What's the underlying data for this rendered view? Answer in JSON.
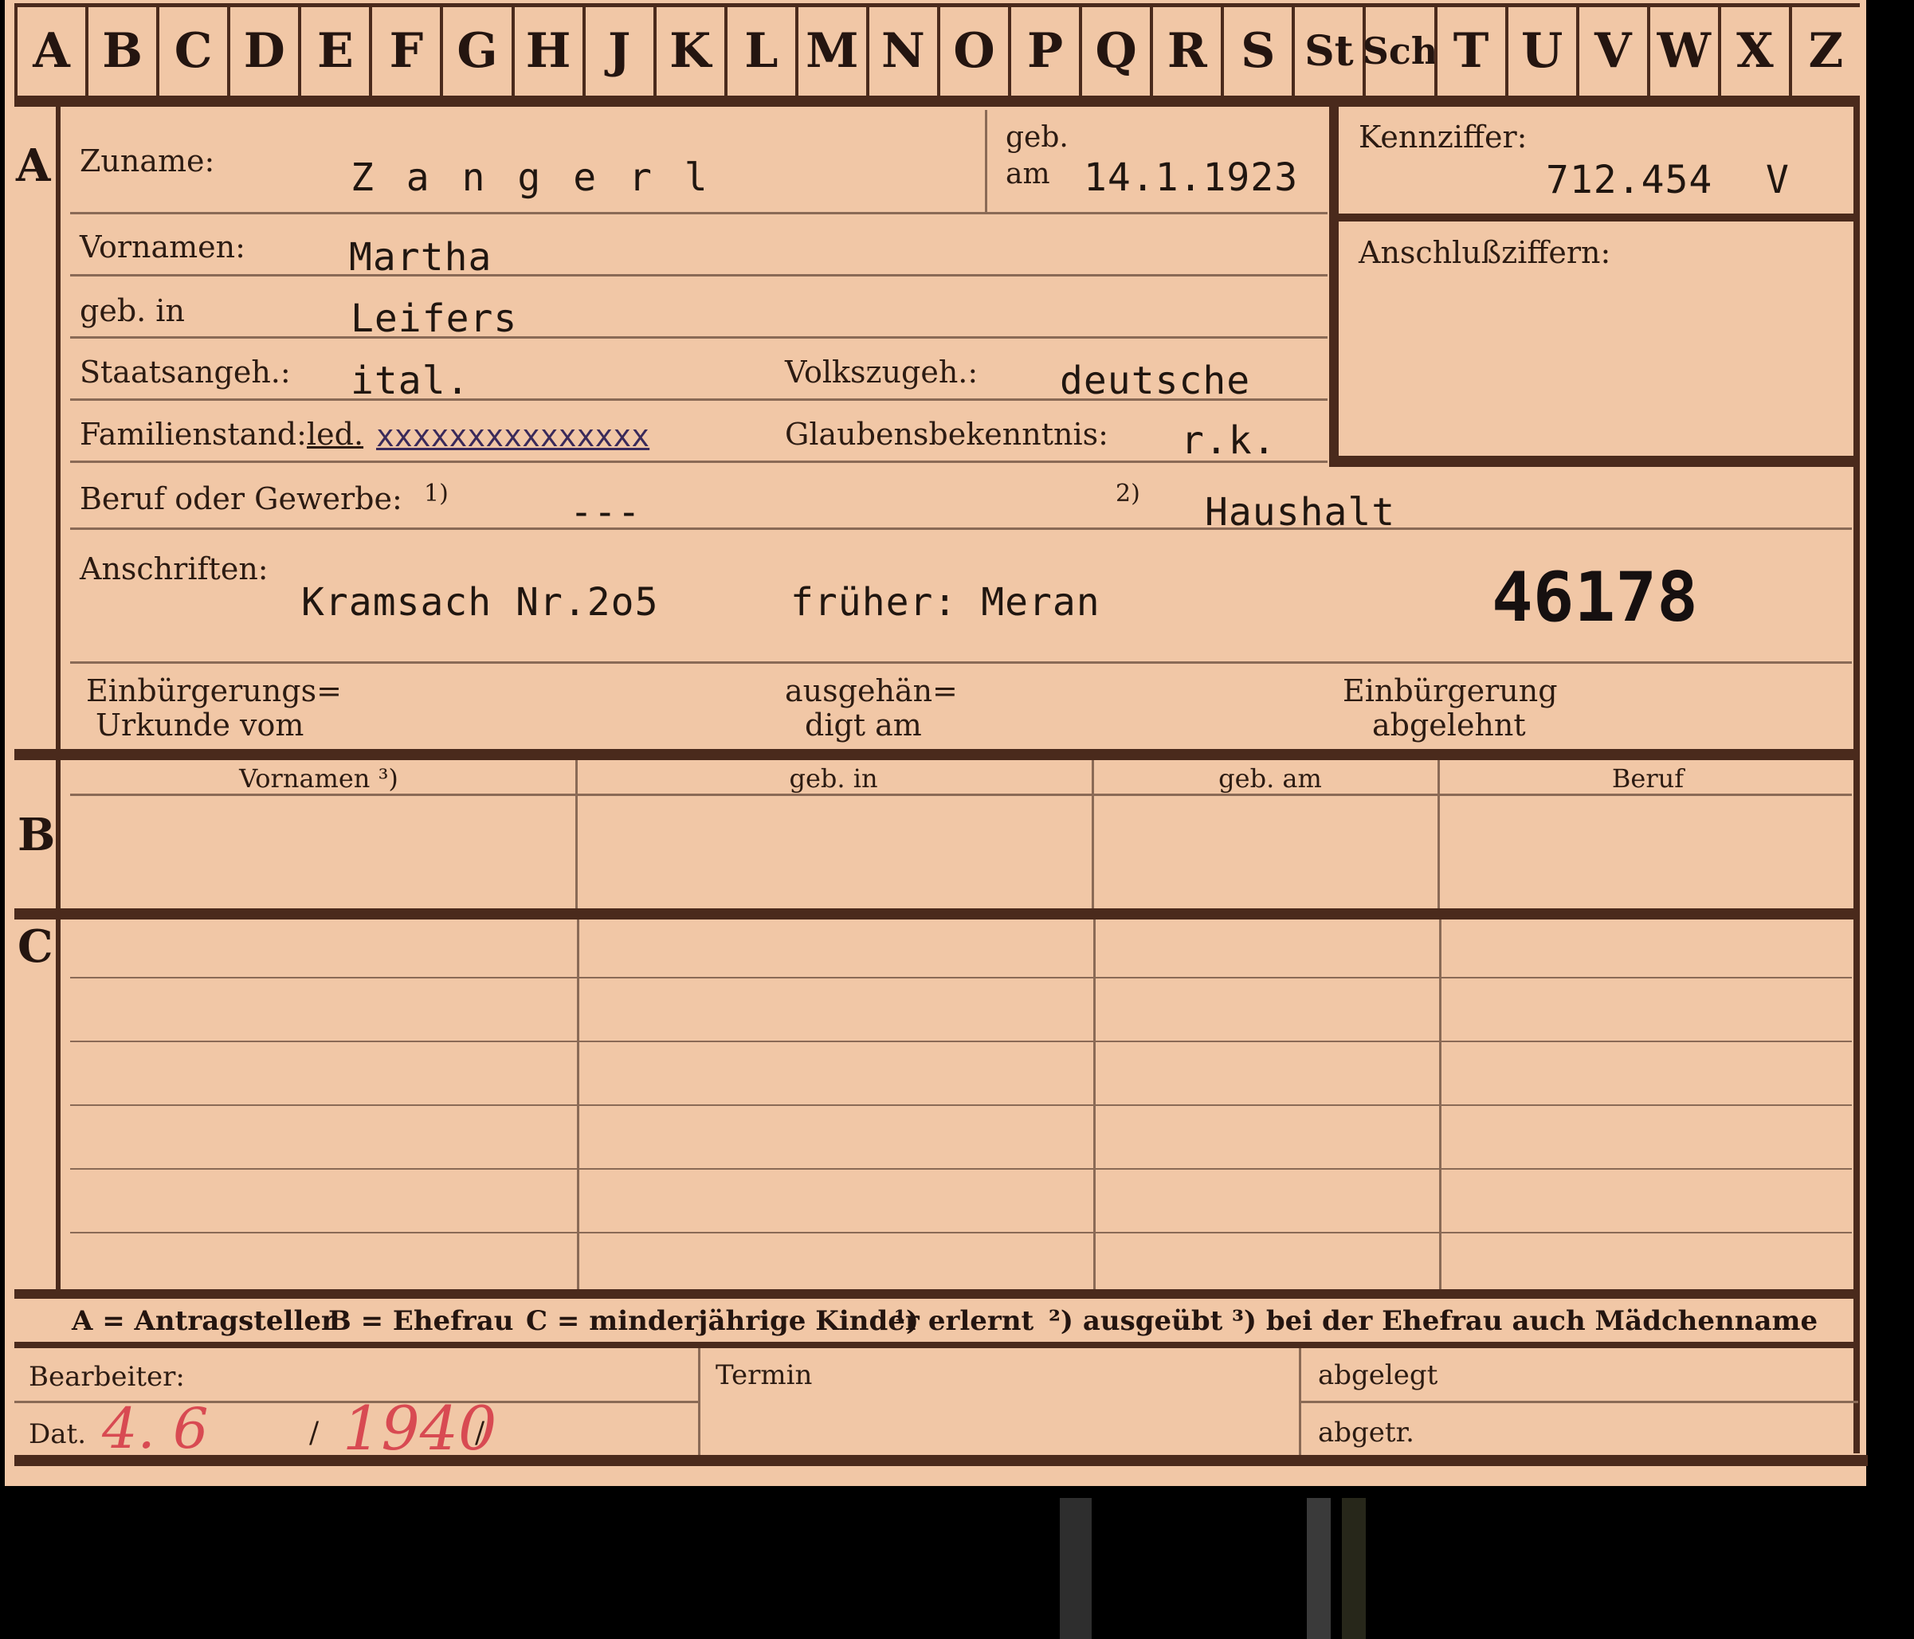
{
  "alphabet_tabs": [
    "A",
    "B",
    "C",
    "D",
    "E",
    "F",
    "G",
    "H",
    "J",
    "K",
    "L",
    "M",
    "N",
    "O",
    "P",
    "Q",
    "R",
    "S",
    "St",
    "Sch",
    "T",
    "U",
    "V",
    "W",
    "X",
    "Z"
  ],
  "section_labels": {
    "a": "A",
    "b": "B",
    "c": "C"
  },
  "applicant": {
    "surname_label": "Zuname:",
    "surname": "Z a n g e r l",
    "born_label_1": "geb.",
    "born_label_2": "am",
    "born_date": "14.1.1923",
    "first_names_label": "Vornamen:",
    "first_names": "Martha",
    "birthplace_label": "geb. in",
    "birthplace": "Leifers",
    "citizenship_label": "Staatsangeh.:",
    "citizenship": "ital.",
    "ethnicity_label": "Volkszugeh.:",
    "ethnicity": "deutsche",
    "family_status_label": "Familienstand:",
    "family_status": "led.",
    "family_status_struck": "xxxxxxxxxxxxxxx",
    "religion_label": "Glaubensbekenntnis:",
    "religion": "r.k.",
    "occupation_label": "Beruf oder Gewerbe:",
    "fn1": "1)",
    "occupation_learned": "---",
    "fn2": "2)",
    "occupation_practiced": "Haushalt",
    "address_label": "Anschriften:",
    "address": "Kramsach Nr.2o5",
    "previous_address": "früher: Meran",
    "stamp_number": "46178",
    "naturalization_cert_label_1": "Einbürgerungs=",
    "naturalization_cert_label_2": "Urkunde vom",
    "handed_out_label_1": "ausgehän=",
    "handed_out_label_2": "digt am",
    "naturalization_denied_label_1": "Einbürgerung",
    "naturalization_denied_label_2": "abgelehnt"
  },
  "id_box": {
    "kennziffer_label": "Kennziffer:",
    "kennziffer": "712.454",
    "kennziffer_suffix": "V",
    "anschluss_label": "Anschlußziffern:"
  },
  "table_headers": [
    "Vornamen ³)",
    "geb. in",
    "geb. am",
    "Beruf"
  ],
  "legend": {
    "a": "A = Antragsteller",
    "b": "B = Ehefrau",
    "c": "C = minderjährige Kinder",
    "n1": "¹) erlernt",
    "n2": "²) ausgeübt",
    "n3": "³) bei der Ehefrau auch Mädchenname"
  },
  "footer": {
    "bearbeiter_label": "Bearbeiter:",
    "dat_label": "Dat.",
    "dat_day_month": "4. 6",
    "dat_sep": "/",
    "dat_year": "1940",
    "termin_label": "Termin",
    "abgelegt_label": "abgelegt",
    "abgetr_label": "abgetr."
  },
  "colors": {
    "card": "#f1c7a6",
    "ink": "#2a1a10",
    "rule": "#4a2a1c",
    "red_pencil": "#d84a52"
  }
}
